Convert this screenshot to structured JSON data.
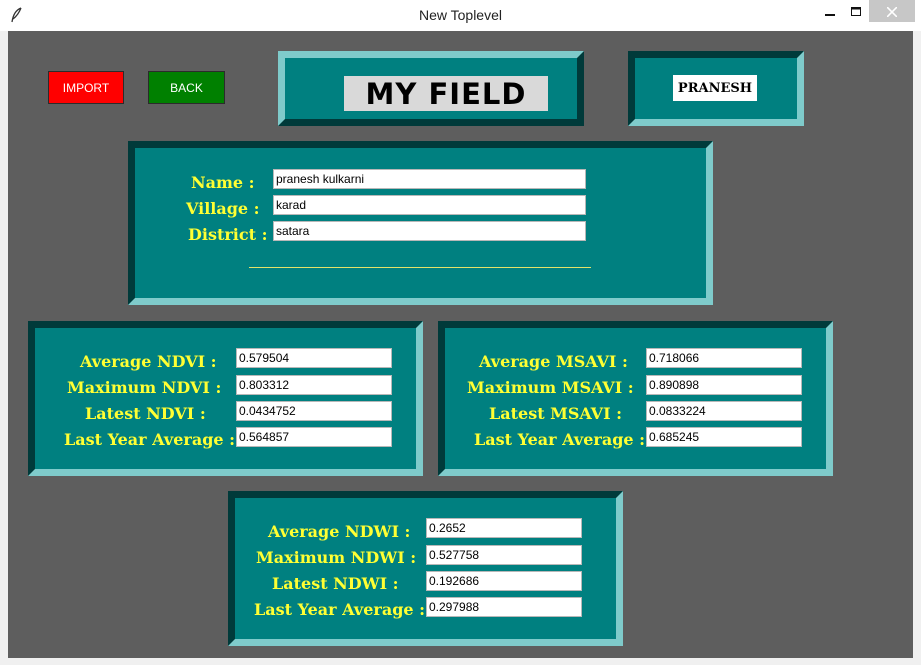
{
  "window": {
    "title": "New Toplevel",
    "icons": {
      "app": "feather-icon",
      "minimize": "minimize-icon",
      "maximize": "maximize-icon",
      "close": "close-icon"
    }
  },
  "toolbar": {
    "import_label": "IMPORT",
    "back_label": "BACK"
  },
  "header": {
    "app_title": "MY FIELD",
    "user_name": "PRANESH"
  },
  "farmer": {
    "name_label": "Name :",
    "name_value": "pranesh kulkarni",
    "village_label": "Village :",
    "village_value": "karad",
    "district_label": "District :",
    "district_value": "satara"
  },
  "ndvi": {
    "avg_label": "Average NDVI :",
    "avg_value": "0.579504",
    "max_label": "Maximum NDVI :",
    "max_value": "0.803312",
    "latest_label": "Latest NDVI :",
    "latest_value": "0.0434752",
    "last_year_label": "Last Year Average :",
    "last_year_value": "0.564857"
  },
  "msavi": {
    "avg_label": "Average MSAVI :",
    "avg_value": "0.718066",
    "max_label": "Maximum MSAVI :",
    "max_value": "0.890898",
    "latest_label": "Latest MSAVI :",
    "latest_value": "0.0833224",
    "last_year_label": "Last Year Average :",
    "last_year_value": "0.685245"
  },
  "ndwi": {
    "avg_label": "Average NDWI :",
    "avg_value": "0.2652",
    "max_label": "Maximum NDWI :",
    "max_value": "0.527758",
    "latest_label": "Latest NDWI :",
    "latest_value": "0.192686",
    "last_year_label": "Last Year Average :",
    "last_year_value": "0.297988"
  },
  "colors": {
    "panel": "#008080",
    "background": "#5e5e5e",
    "label": "#ffff33",
    "import": "#ff0000",
    "back": "#008000"
  }
}
